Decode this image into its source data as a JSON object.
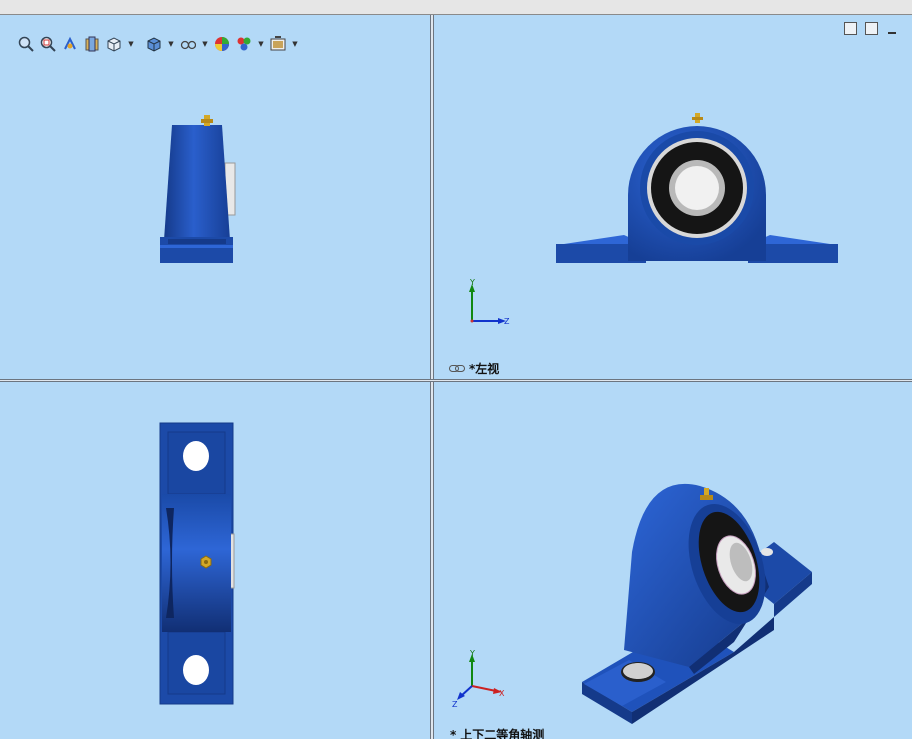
{
  "toolbar": {
    "items": [
      {
        "name": "zoom-to-fit-icon",
        "dropdown": false
      },
      {
        "name": "zoom-to-area-icon",
        "dropdown": false
      },
      {
        "name": "previous-view-icon",
        "dropdown": false
      },
      {
        "name": "section-view-icon",
        "dropdown": false
      },
      {
        "name": "view-orientation-icon",
        "dropdown": true
      },
      {
        "name": "display-style-icon",
        "dropdown": true
      },
      {
        "name": "hide-show-items-icon",
        "dropdown": true
      },
      {
        "name": "edit-appearance-icon",
        "dropdown": false
      },
      {
        "name": "apply-scene-icon",
        "dropdown": true
      },
      {
        "name": "view-settings-icon",
        "dropdown": true
      }
    ]
  },
  "viewports": {
    "top_right": {
      "label_prefix": "*",
      "label": "左视",
      "axes": {
        "vertical": "Y",
        "horizontal": "Z",
        "origin": "X"
      }
    },
    "bottom_right": {
      "label_prefix": "*",
      "label": "上下二等角轴测",
      "axes": {
        "vertical": "Y",
        "right": "X",
        "diag": "Z"
      }
    }
  },
  "colors": {
    "viewport_bg": "#b3d9f7",
    "housing_blue": "#1f4fb4",
    "housing_dark": "#153a8a",
    "grease_fitting": "#d4a826",
    "bearing_black": "#151515",
    "bearing_silver": "#d8d8d8"
  }
}
